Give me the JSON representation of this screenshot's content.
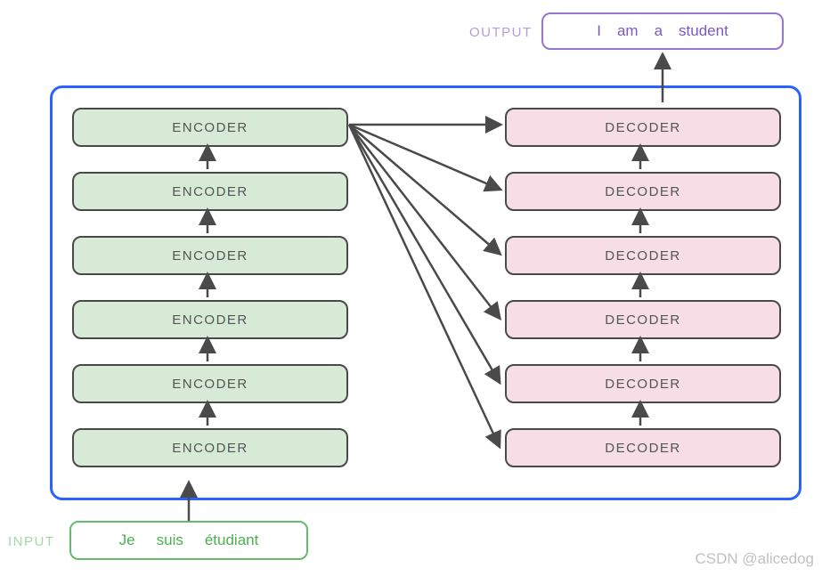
{
  "output": {
    "label": "OUTPUT",
    "tokens": [
      "I",
      "am",
      "a",
      "student"
    ]
  },
  "input": {
    "label": "INPUT",
    "tokens": [
      "Je",
      "suis",
      "étudiant"
    ]
  },
  "encoders": [
    "ENCODER",
    "ENCODER",
    "ENCODER",
    "ENCODER",
    "ENCODER",
    "ENCODER"
  ],
  "decoders": [
    "DECODER",
    "DECODER",
    "DECODER",
    "DECODER",
    "DECODER",
    "DECODER"
  ],
  "watermark": "CSDN @alicedog",
  "colors": {
    "containerBorder": "#2962ff",
    "encoderFill": "#d7ead5",
    "decoderFill": "#f6dde6",
    "blockBorder": "#4a4a4a",
    "outputBorder": "#9575cd",
    "inputBorder": "#66bb6a",
    "arrow": "#4a4a4a"
  },
  "chart_data": {
    "type": "diagram",
    "title": "Transformer encoder-decoder architecture",
    "encoder_layers": 6,
    "decoder_layers": 6,
    "encoder_flow": "bottom-to-top stacked, sequential",
    "decoder_flow": "bottom-to-top stacked, sequential",
    "cross_connections": "top encoder output feeds all 6 decoder layers",
    "input_example": [
      "Je",
      "suis",
      "étudiant"
    ],
    "output_example": [
      "I",
      "am",
      "a",
      "student"
    ]
  }
}
